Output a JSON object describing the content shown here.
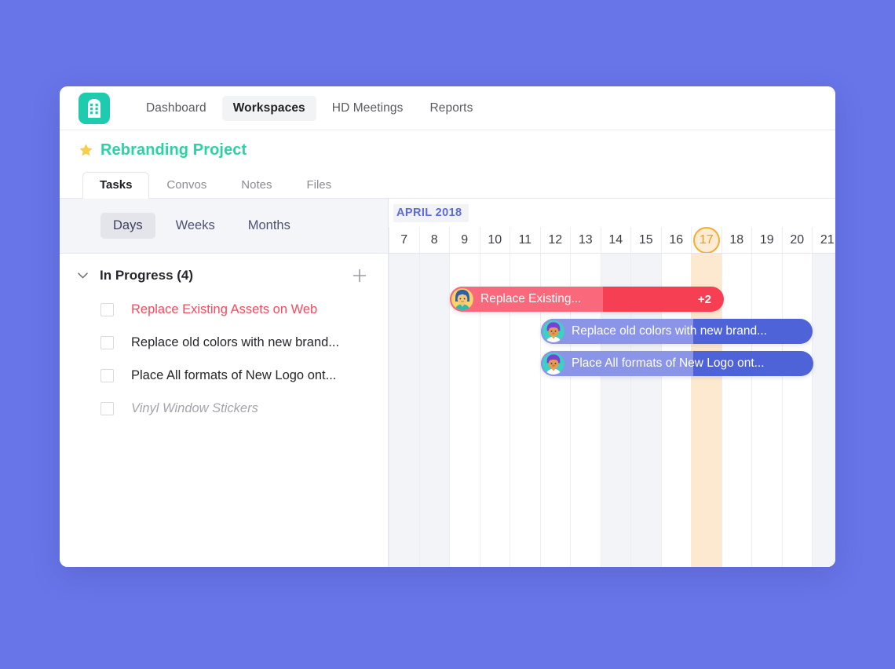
{
  "page": {
    "background_color": "#6875e8",
    "card_background": "#ffffff"
  },
  "topnav": {
    "logo_icon": "building-grid-icon",
    "logo_color": "#1ecbae",
    "links": [
      {
        "label": "Dashboard",
        "active": false
      },
      {
        "label": "Workspaces",
        "active": true
      },
      {
        "label": "HD Meetings",
        "active": false
      },
      {
        "label": "Reports",
        "active": false
      }
    ]
  },
  "project": {
    "star_icon": "star-icon",
    "star_color": "#f7ce4a",
    "title": "Rebranding Project",
    "title_color": "#2bd3a4"
  },
  "tabs": [
    {
      "label": "Tasks",
      "active": true
    },
    {
      "label": "Convos",
      "active": false
    },
    {
      "label": "Notes",
      "active": false
    },
    {
      "label": "Files",
      "active": false
    }
  ],
  "view_toolbar": {
    "options": [
      {
        "label": "Days",
        "active": true
      },
      {
        "label": "Weeks",
        "active": false
      },
      {
        "label": "Months",
        "active": false
      }
    ]
  },
  "task_group": {
    "chevron_icon": "chevron-down-icon",
    "title": "In Progress (4)",
    "add_icon": "plus-icon",
    "tasks": [
      {
        "label": "Replace Existing Assets on Web",
        "style": "accent-red",
        "checked": false
      },
      {
        "label": "Replace old colors with new brand...",
        "style": "normal",
        "checked": false
      },
      {
        "label": "Place All formats of New Logo ont...",
        "style": "normal",
        "checked": false
      },
      {
        "label": "Vinyl Window Stickers",
        "style": "muted",
        "checked": false
      }
    ]
  },
  "timeline": {
    "month_label": "APRIL 2018",
    "month_label_color": "#5b6ae0",
    "days": [
      {
        "label": "7",
        "weekend": true,
        "today": false
      },
      {
        "label": "8",
        "weekend": true,
        "today": false
      },
      {
        "label": "9",
        "weekend": false,
        "today": false
      },
      {
        "label": "10",
        "weekend": false,
        "today": false
      },
      {
        "label": "11",
        "weekend": false,
        "today": false
      },
      {
        "label": "12",
        "weekend": false,
        "today": false
      },
      {
        "label": "13",
        "weekend": false,
        "today": false
      },
      {
        "label": "14",
        "weekend": true,
        "today": false
      },
      {
        "label": "15",
        "weekend": true,
        "today": false
      },
      {
        "label": "16",
        "weekend": false,
        "today": false
      },
      {
        "label": "17",
        "weekend": false,
        "today": true
      },
      {
        "label": "18",
        "weekend": false,
        "today": false
      },
      {
        "label": "19",
        "weekend": false,
        "today": false
      },
      {
        "label": "20",
        "weekend": false,
        "today": false
      },
      {
        "label": "21",
        "weekend": true,
        "today": false
      }
    ],
    "today_day": "17",
    "today_highlight_color": "#fde9cf",
    "bars": [
      {
        "id": "bar-red",
        "text": "Replace Existing...",
        "count_badge": "+2",
        "color": "#f63f53",
        "color_light": "#f9697b",
        "avatar": "avatar-female-blue-hair"
      },
      {
        "id": "bar-blue-1",
        "text": "Replace old colors with new brand...",
        "count_badge": "",
        "color": "#4f63d8",
        "color_light": "#8b95e8",
        "avatar": "avatar-male-purple-hair"
      },
      {
        "id": "bar-blue-2",
        "text": "Place All formats of New Logo ont...",
        "count_badge": "",
        "color": "#4f63d8",
        "color_light": "#8b95e8",
        "avatar": "avatar-male-purple-hair"
      }
    ]
  }
}
